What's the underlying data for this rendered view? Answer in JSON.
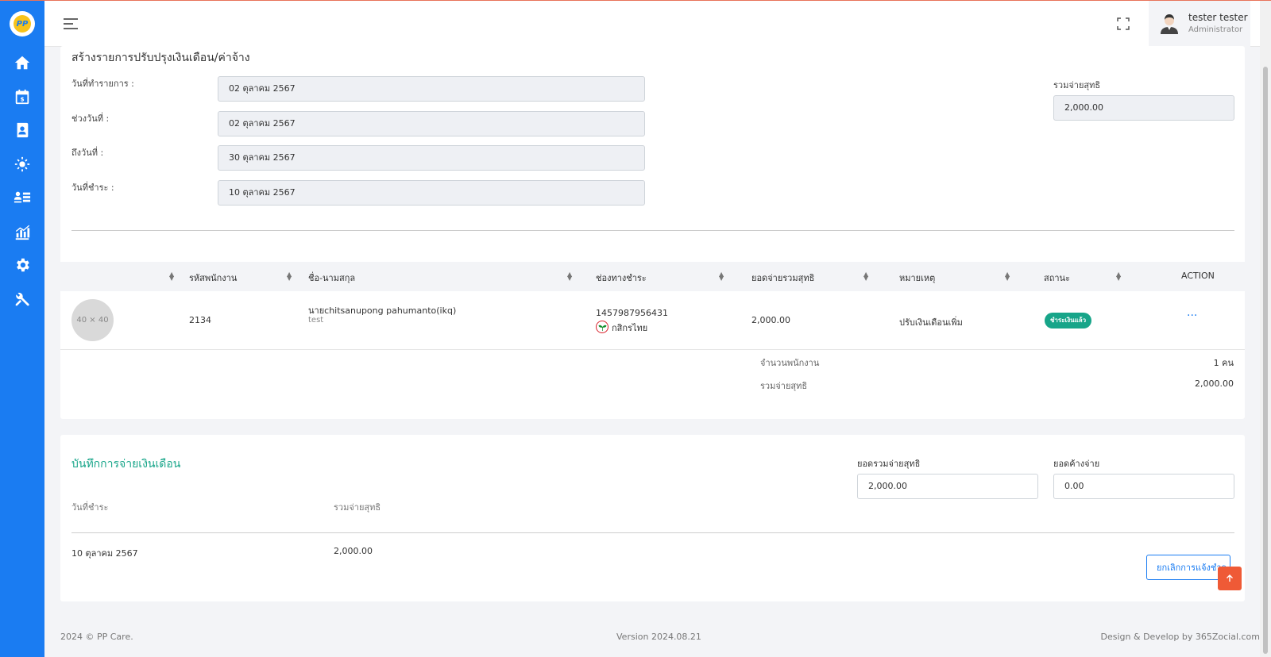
{
  "user": {
    "name": "tester tester",
    "role": "Administrator"
  },
  "form": {
    "title": "สร้างรายการปรับปรุงเงินเดือน/ค่าจ้าง",
    "fields": [
      {
        "label": "วันที่ทำรายการ :",
        "value": "02 ตุลาคม 2567"
      },
      {
        "label": "ช่วงวันที่ :",
        "value": "02 ตุลาคม 2567"
      },
      {
        "label": "ถึงวันที่ :",
        "value": "30 ตุลาคม 2567"
      },
      {
        "label": "วันที่ชำระ :",
        "value": "10 ตุลาคม 2567"
      }
    ],
    "net_label": "รวมจ่ายสุทธิ",
    "net_value": "2,000.00"
  },
  "table": {
    "headers": [
      "รหัสพนักงาน",
      "ชื่อ-นามสกุล",
      "ช่องทางชำระ",
      "ยอดจ่ายรวมสุทธิ",
      "หมายเหตุ",
      "สถานะ",
      "ACTION"
    ],
    "row": {
      "thumb": "40 × 40",
      "emp_id": "2134",
      "name": "นายchitsanupong pahumanto(ikq)",
      "sub": "test",
      "account": "1457987956431",
      "bank": "กสิกรไทย",
      "amount": "2,000.00",
      "note": "ปรับเงินเดือนเพิ่ม",
      "status": "ชำระเงินแล้ว",
      "action": "···"
    },
    "summary": [
      {
        "label": "จำนวนพนักงาน",
        "value": "1 คน"
      },
      {
        "label": "รวมจ่ายสุทธิ",
        "value": "2,000.00"
      }
    ]
  },
  "payment": {
    "title": "บันทึกการจ่ายเงินเดือน",
    "total_label": "ยอดรวมจ่ายสุทธิ",
    "total_value": "2,000.00",
    "outstanding_label": "ยอดค้างจ่าย",
    "outstanding_value": "0.00",
    "col_date": "วันที่ชำระ",
    "col_net": "รวมจ่ายสุทธิ",
    "row_date": "10 ตุลาคม 2567",
    "row_net": "2,000.00",
    "cancel_label": "ยกเลิกการแจ้งชำระ"
  },
  "footer": {
    "left": "2024 © PP Care.",
    "center": "Version 2024.08.21",
    "right": "Design & Develop by 365Zocial.com"
  },
  "colors": {
    "sidebar": "#1a7cf2",
    "accent_green": "#17a589",
    "to_top": "#ef5a36"
  }
}
